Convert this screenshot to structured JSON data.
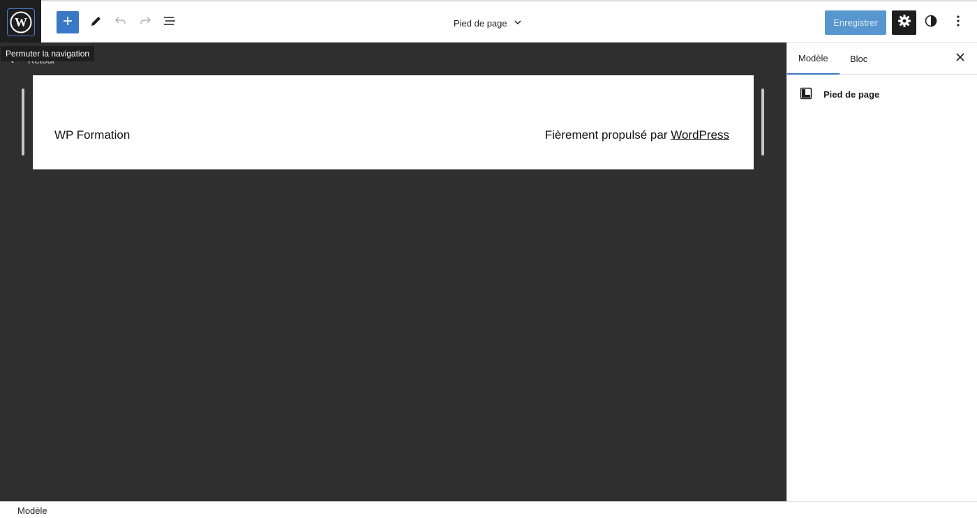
{
  "header": {
    "doc_title": "Pied de page",
    "save_label": "Enregistrer"
  },
  "canvas": {
    "back_label": "Retour",
    "tooltip": "Permuter la navigation",
    "site_title": "WP Formation",
    "credit_prefix": "Fièrement propulsé par",
    "credit_link": "WordPress"
  },
  "sidebar": {
    "tab_model": "Modèle",
    "tab_block": "Bloc",
    "template_name": "Pied de page"
  },
  "footer": {
    "breadcrumb": "Modèle"
  },
  "icons": {
    "logo": "wordpress-icon",
    "add": "plus-icon",
    "edit": "pencil-icon",
    "undo": "undo-icon",
    "redo": "redo-icon",
    "list": "list-view-icon",
    "chevron": "chevron-down-icon",
    "settings": "gear-icon",
    "styles": "half-circle-icon",
    "more": "more-vertical-icon",
    "close": "close-icon",
    "template": "template-part-icon"
  },
  "colors": {
    "accent": "#3878c5",
    "canvas_bg": "#2f2f2f",
    "dark": "#1e1e1e"
  }
}
